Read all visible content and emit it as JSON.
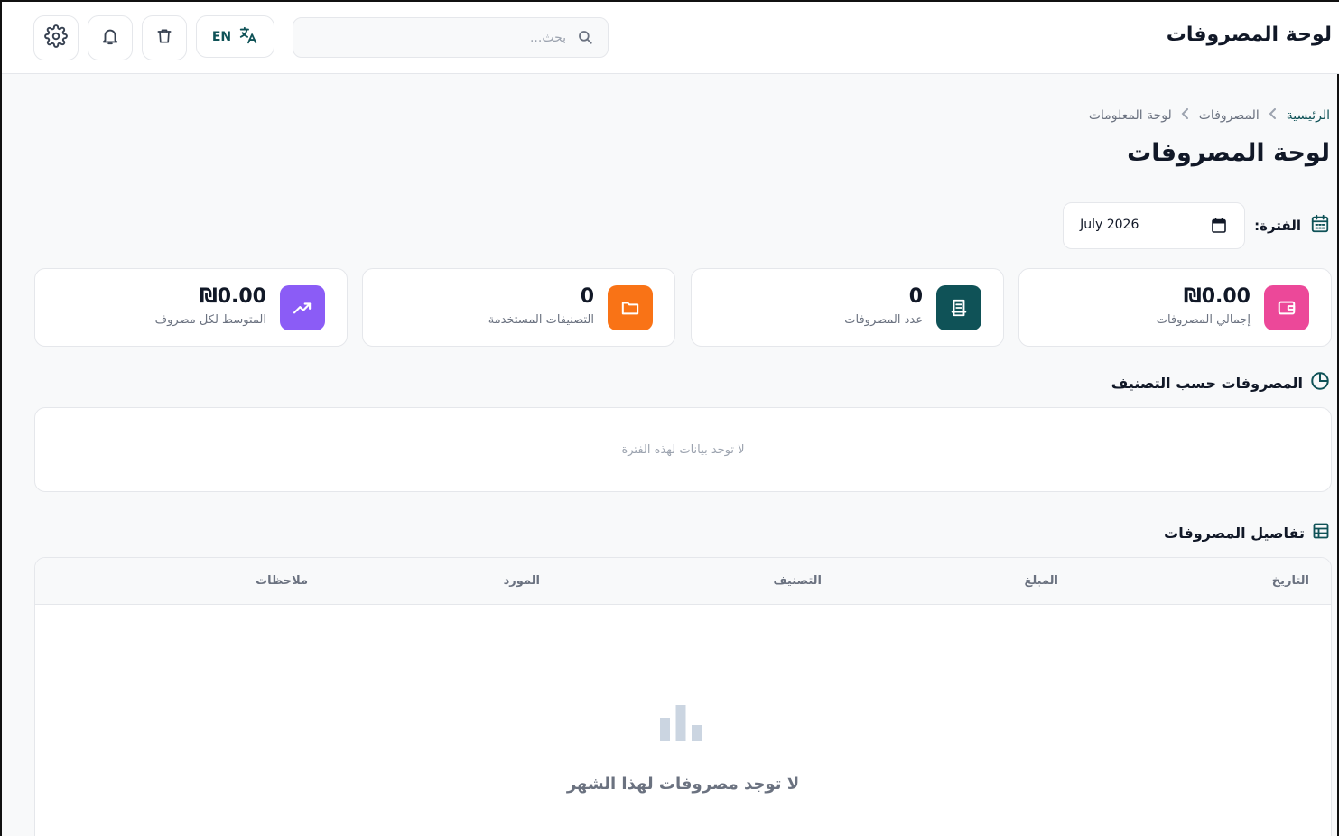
{
  "header": {
    "app_title": "لوحة المصروفات",
    "search_placeholder": "بحث...",
    "language_label": "EN",
    "icons": {
      "settings": "gear-icon",
      "notifications": "bell-icon",
      "trash": "trash-icon",
      "translate": "translate-icon",
      "search": "search-icon"
    }
  },
  "breadcrumb": {
    "items": [
      "الرئيسية",
      "المصروفات",
      "لوحة المعلومات"
    ]
  },
  "page": {
    "title": "لوحة المصروفات"
  },
  "period": {
    "label": "الفترة:",
    "value": "July 2026"
  },
  "stats": [
    {
      "value": "₪0.00",
      "label": "إجمالي المصروفات",
      "icon": "wallet-icon",
      "color": "#ec4899"
    },
    {
      "value": "0",
      "label": "عدد المصروفات",
      "icon": "receipt-icon",
      "color": "#0f5257"
    },
    {
      "value": "0",
      "label": "التصنيفات المستخدمة",
      "icon": "folder-icon",
      "color": "#f97316"
    },
    {
      "value": "₪0.00",
      "label": "المتوسط لكل مصروف",
      "icon": "trend-up-icon",
      "color": "#8b5cf6"
    }
  ],
  "by_category": {
    "title": "المصروفات حسب التصنيف",
    "empty_text": "لا توجد بيانات لهذه الفترة"
  },
  "details": {
    "title": "تفاصيل المصروفات",
    "columns": [
      "التاريخ",
      "المبلغ",
      "التصنيف",
      "المورد",
      "ملاحظات"
    ],
    "empty_text": "لا توجد مصروفات لهذا الشهر"
  },
  "colors": {
    "accent": "#0f5257"
  }
}
